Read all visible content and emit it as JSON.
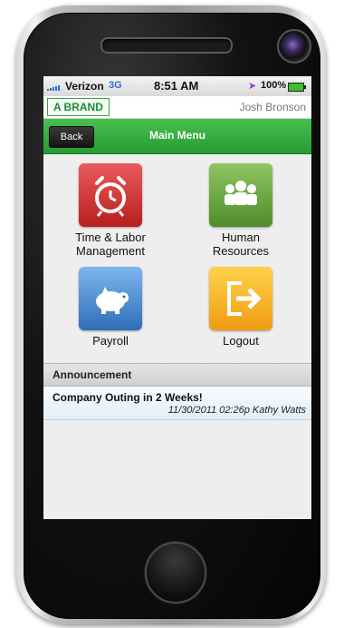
{
  "status_bar": {
    "carrier": "Verizon",
    "network": "3G",
    "time": "8:51 AM",
    "location_icon": "location-arrow-icon",
    "battery_percent": "100%"
  },
  "brand": {
    "logo_text": "A BRAND",
    "user_name": "Josh Bronson"
  },
  "header": {
    "back_label": "Back",
    "title": "Main Menu"
  },
  "menu": {
    "items": [
      {
        "label_line1": "Time & Labor",
        "label_line2": "Management",
        "icon": "alarm-clock-icon",
        "color": "#d33a3a"
      },
      {
        "label_line1": "Human",
        "label_line2": "Resources",
        "icon": "people-group-icon",
        "color": "#6aa83f"
      },
      {
        "label_line1": "Payroll",
        "label_line2": "",
        "icon": "piggy-bank-icon",
        "color": "#4d8fd4"
      },
      {
        "label_line1": "Logout",
        "label_line2": "",
        "icon": "logout-arrow-icon",
        "color": "#f5b21f"
      }
    ]
  },
  "announcement": {
    "header": "Announcement",
    "items": [
      {
        "title": "Company Outing in 2 Weeks!",
        "meta": "11/30/2011 02:26p Kathy Watts"
      }
    ]
  },
  "colors": {
    "title_bar": "#34ae40",
    "brand_green": "#1d8b35"
  }
}
